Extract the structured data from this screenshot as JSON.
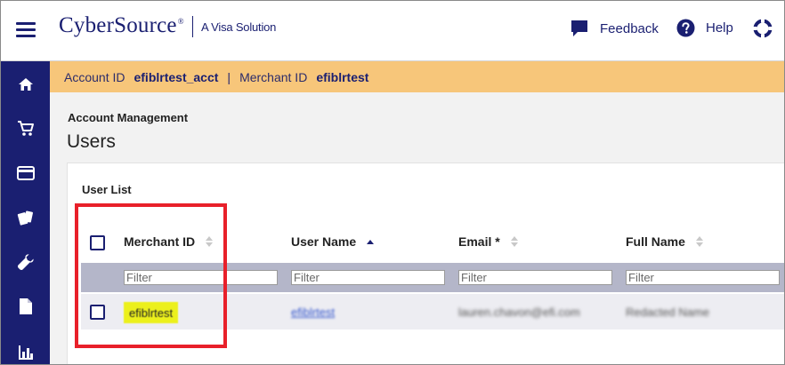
{
  "header": {
    "brand": "CyberSource",
    "brand_reg": "®",
    "brand_sub": "A Visa Solution",
    "feedback_label": "Feedback",
    "help_label": "Help"
  },
  "sidebar": {
    "items": [
      {
        "icon": "home-icon"
      },
      {
        "icon": "cart-icon"
      },
      {
        "icon": "credit-card-icon"
      },
      {
        "icon": "cards-icon"
      },
      {
        "icon": "wrench-icon"
      },
      {
        "icon": "document-icon"
      },
      {
        "icon": "bar-chart-icon"
      }
    ]
  },
  "account_bar": {
    "account_label": "Account ID",
    "account_value": "efiblrtest_acct",
    "separator": "|",
    "merchant_label": "Merchant ID",
    "merchant_value": "efiblrtest"
  },
  "page": {
    "breadcrumb": "Account Management",
    "title": "Users"
  },
  "user_list": {
    "title": "User List",
    "columns": [
      {
        "label": "Merchant ID",
        "sort": "none"
      },
      {
        "label": "User Name",
        "sort": "asc"
      },
      {
        "label": "Email *",
        "sort": "none"
      },
      {
        "label": "Full Name",
        "sort": "none"
      }
    ],
    "filter_placeholder": "Filter",
    "rows": [
      {
        "merchant_id": "efiblrtest",
        "user_name": "efiblrtest",
        "email": "lauren.chavon@efi.com",
        "full_name": "Redacted Name"
      }
    ]
  },
  "colors": {
    "brand_navy": "#1a1f71",
    "account_bar": "#f7c67a",
    "highlight": "#ecf01c",
    "annotation_red": "#e8202a"
  }
}
